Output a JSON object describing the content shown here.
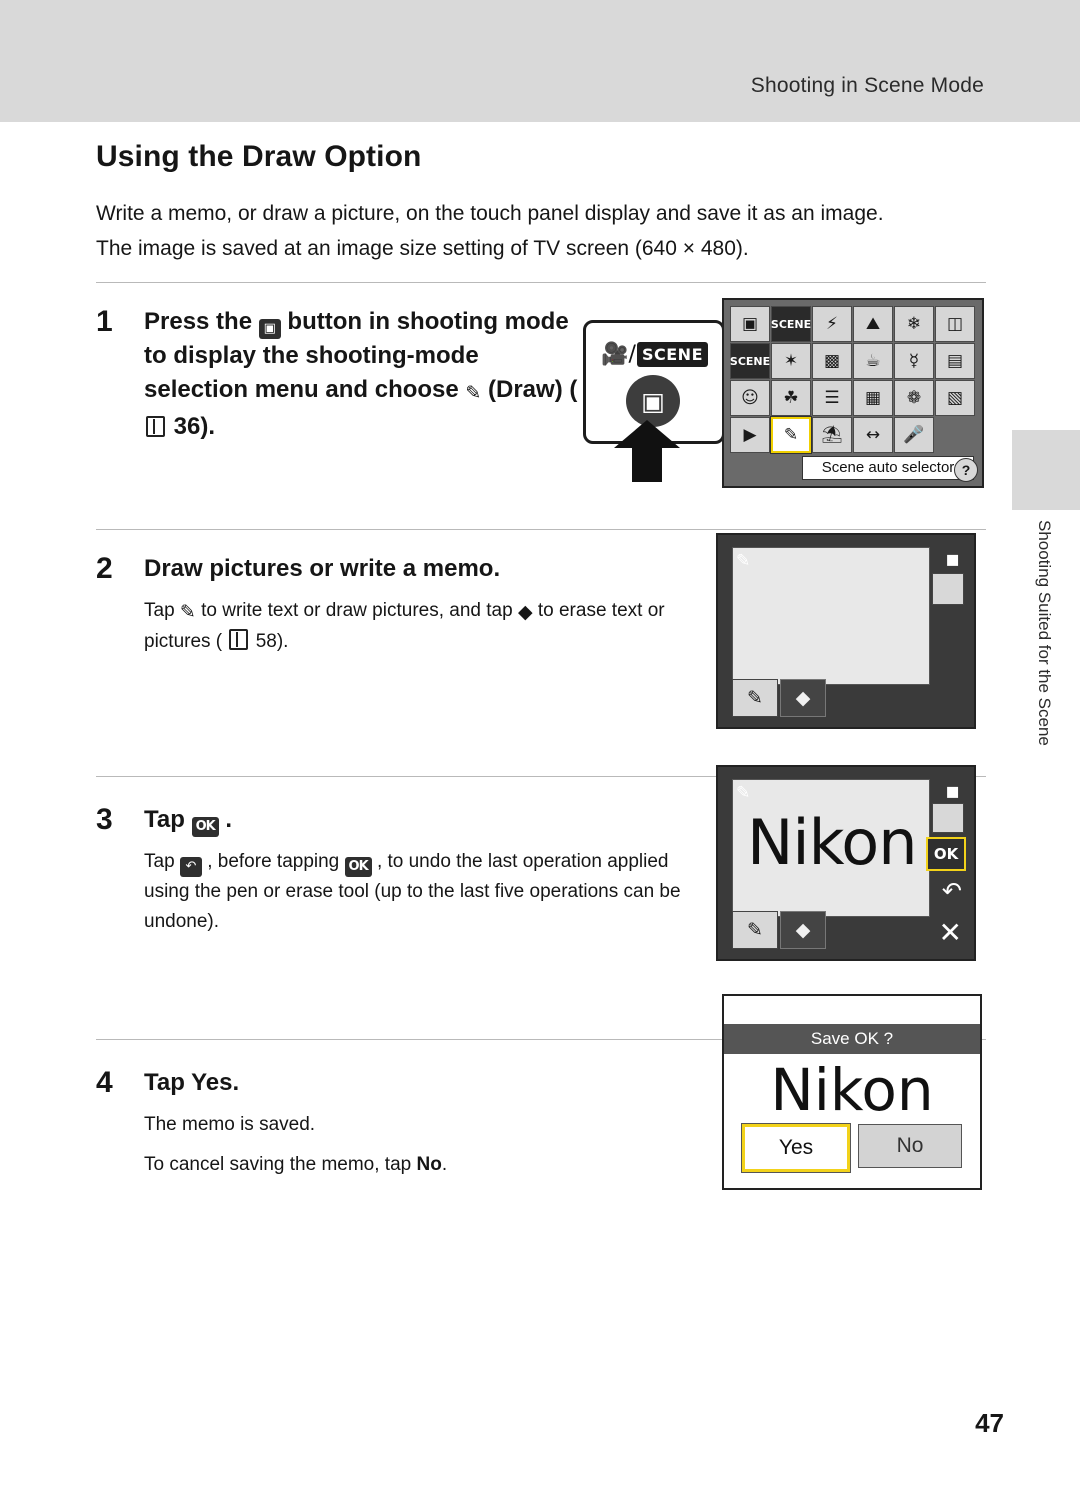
{
  "header": {
    "running_title": "Shooting in Scene Mode"
  },
  "side_tab": {
    "label": "Shooting Suited for the Scene"
  },
  "page": {
    "title": "Using the Draw Option",
    "intro": "Write a memo, or draw a picture, on the touch panel display and save it as an image. The image is saved at an image size setting of TV screen (640 × 480).",
    "number": "47"
  },
  "steps": [
    {
      "num": "1",
      "head_before": "Press the",
      "head_icon": "camera-mode-icon",
      "head_mid": "button in shooting mode to display the shooting-mode selection menu and choose",
      "head_icon2": "draw-pencil-icon",
      "head_after": "(Draw) (",
      "head_ref": "36).",
      "sub": ""
    },
    {
      "num": "2",
      "head": "Draw pictures or write a memo.",
      "sub_a": "Tap",
      "sub_b": "to write text or draw pictures, and tap",
      "sub_c": "to erase text or pictures (",
      "sub_ref": "58)."
    },
    {
      "num": "3",
      "head_before": "Tap",
      "head_icon": "OK",
      "head_after": ".",
      "sub_a": "Tap",
      "sub_b": ", before tapping",
      "sub_c": ", to undo the last operation applied using the pen or erase tool (up to the last five operations can be undone)."
    },
    {
      "num": "4",
      "head_before": "Tap",
      "head_bold": "Yes",
      "head_after": ".",
      "sub_a": "The memo is saved.",
      "sub_b_before": "To cancel saving the memo, tap",
      "sub_b_bold": "No",
      "sub_b_after": "."
    }
  ],
  "figure_scene_menu": {
    "mode_left_icon": "movie-scene-mode-icon",
    "mode_right_label": "SCENE",
    "shutter_icon": "camera-icon",
    "selected_label": "Scene auto selector",
    "help_label": "?",
    "cells": [
      "▣",
      "SCENE",
      "⚡",
      "⛰",
      "❄",
      "◫",
      "SCENE",
      "✦",
      "░",
      "☕",
      "✿",
      "▤",
      "☺",
      "☘",
      "☰",
      "▦",
      "❁",
      "▧",
      "▶",
      "✎",
      "◱",
      "↔",
      "↓"
    ]
  },
  "figure_draw_screen2": {
    "pen_icon": "pen-icon",
    "eraser_icon": "eraser-icon",
    "top_badge": "draw-indicator",
    "dot_badge": "recording-dot"
  },
  "figure_draw_screen3": {
    "drawing_text": "Nikon",
    "ok_label": "OK",
    "undo_icon": "undo-arrow-icon",
    "close_icon": "close-x-icon",
    "pen_icon": "pen-icon",
    "eraser_icon": "eraser-icon"
  },
  "figure_save_dialog": {
    "title": "Save OK ?",
    "drawing_text": "Nikon",
    "yes_label": "Yes",
    "no_label": "No"
  }
}
